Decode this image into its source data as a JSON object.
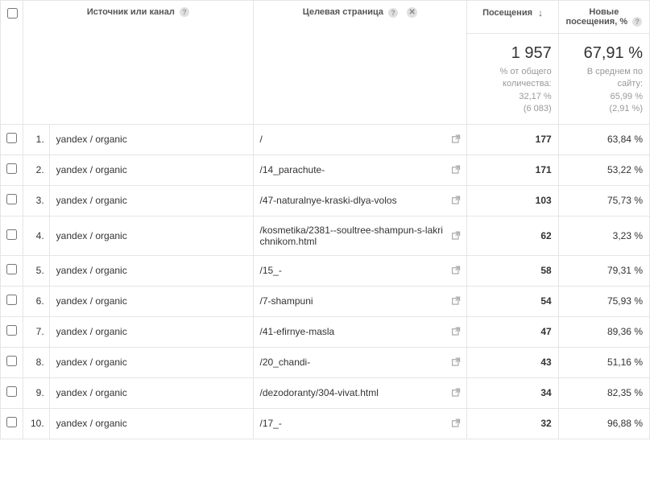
{
  "headers": {
    "source": "Источник или канал",
    "landing_page": "Целевая страница",
    "visits": "Посещения",
    "new_visits": "Новые посещения, %"
  },
  "summary": {
    "visits_total": "1 957",
    "visits_sub_line1": "% от общего",
    "visits_sub_line2": "количества:",
    "visits_sub_line3": "32,17 %",
    "visits_sub_line4": "(6 083)",
    "newv_total": "67,91 %",
    "newv_sub_line1": "В среднем по",
    "newv_sub_line2": "сайту:",
    "newv_sub_line3": "65,99 %",
    "newv_sub_line4": "(2,91 %)"
  },
  "rows": [
    {
      "n": "1.",
      "src": "yandex / organic",
      "page": "/",
      "visits": "177",
      "newv": "63,84 %"
    },
    {
      "n": "2.",
      "src": "yandex / organic",
      "page": "/14_parachute-",
      "visits": "171",
      "newv": "53,22 %"
    },
    {
      "n": "3.",
      "src": "yandex / organic",
      "page": "/47-naturalnye-kraski-dlya-volos",
      "visits": "103",
      "newv": "75,73 %"
    },
    {
      "n": "4.",
      "src": "yandex / organic",
      "page": "/kosmetika/2381--soultree-shampun-s-lakrichnikom.html",
      "visits": "62",
      "newv": "3,23 %"
    },
    {
      "n": "5.",
      "src": "yandex / organic",
      "page": "/15_-",
      "visits": "58",
      "newv": "79,31 %"
    },
    {
      "n": "6.",
      "src": "yandex / organic",
      "page": "/7-shampuni",
      "visits": "54",
      "newv": "75,93 %"
    },
    {
      "n": "7.",
      "src": "yandex / organic",
      "page": "/41-efirnye-masla",
      "visits": "47",
      "newv": "89,36 %"
    },
    {
      "n": "8.",
      "src": "yandex / organic",
      "page": "/20_chandi-",
      "visits": "43",
      "newv": "51,16 %"
    },
    {
      "n": "9.",
      "src": "yandex / organic",
      "page": "/dezodoranty/304-vivat.html",
      "visits": "34",
      "newv": "82,35 %"
    },
    {
      "n": "10.",
      "src": "yandex / organic",
      "page": "/17_-",
      "visits": "32",
      "newv": "96,88 %"
    }
  ]
}
